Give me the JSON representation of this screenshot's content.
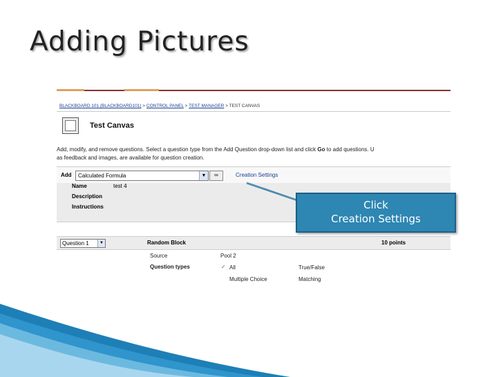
{
  "slide": {
    "title": "Adding Pictures"
  },
  "breadcrumb": {
    "items": [
      "BLACKBOARD 101 (BLACKBOARD101)",
      "CONTROL PANEL",
      "TEST MANAGER",
      "TEST CANVAS"
    ],
    "separator": " > "
  },
  "page": {
    "heading": "Test Canvas"
  },
  "description": {
    "line1_start": "Add, modify, and remove questions. Select a question type from the Add Question drop-down list and click ",
    "line1_bold": "Go",
    "line1_end": " to add questions. U",
    "line2": "as feedback and images, are available for question creation."
  },
  "add_bar": {
    "label": "Add",
    "select_value": "Calculated Formula",
    "go_label": "∞",
    "creation_settings": "Creation Settings"
  },
  "info": {
    "name_label": "Name",
    "name_value": "test 4",
    "description_label": "Description",
    "instructions_label": "Instructions"
  },
  "question_bar": {
    "select_value": "Question 1",
    "block_label": "Random Block",
    "points": "10 points"
  },
  "details": {
    "source_label": "Source",
    "source_value": "Pool 2",
    "question_types_label": "Question types",
    "check": "✓",
    "types": [
      "All",
      "True/False",
      "Multiple Choice",
      "Matching"
    ]
  },
  "callout": {
    "line1": "Click",
    "line2": "Creation Settings"
  },
  "colors": {
    "callout": "#2e86b3",
    "wave": "#1e7fb6",
    "link": "#1a3f8f"
  }
}
